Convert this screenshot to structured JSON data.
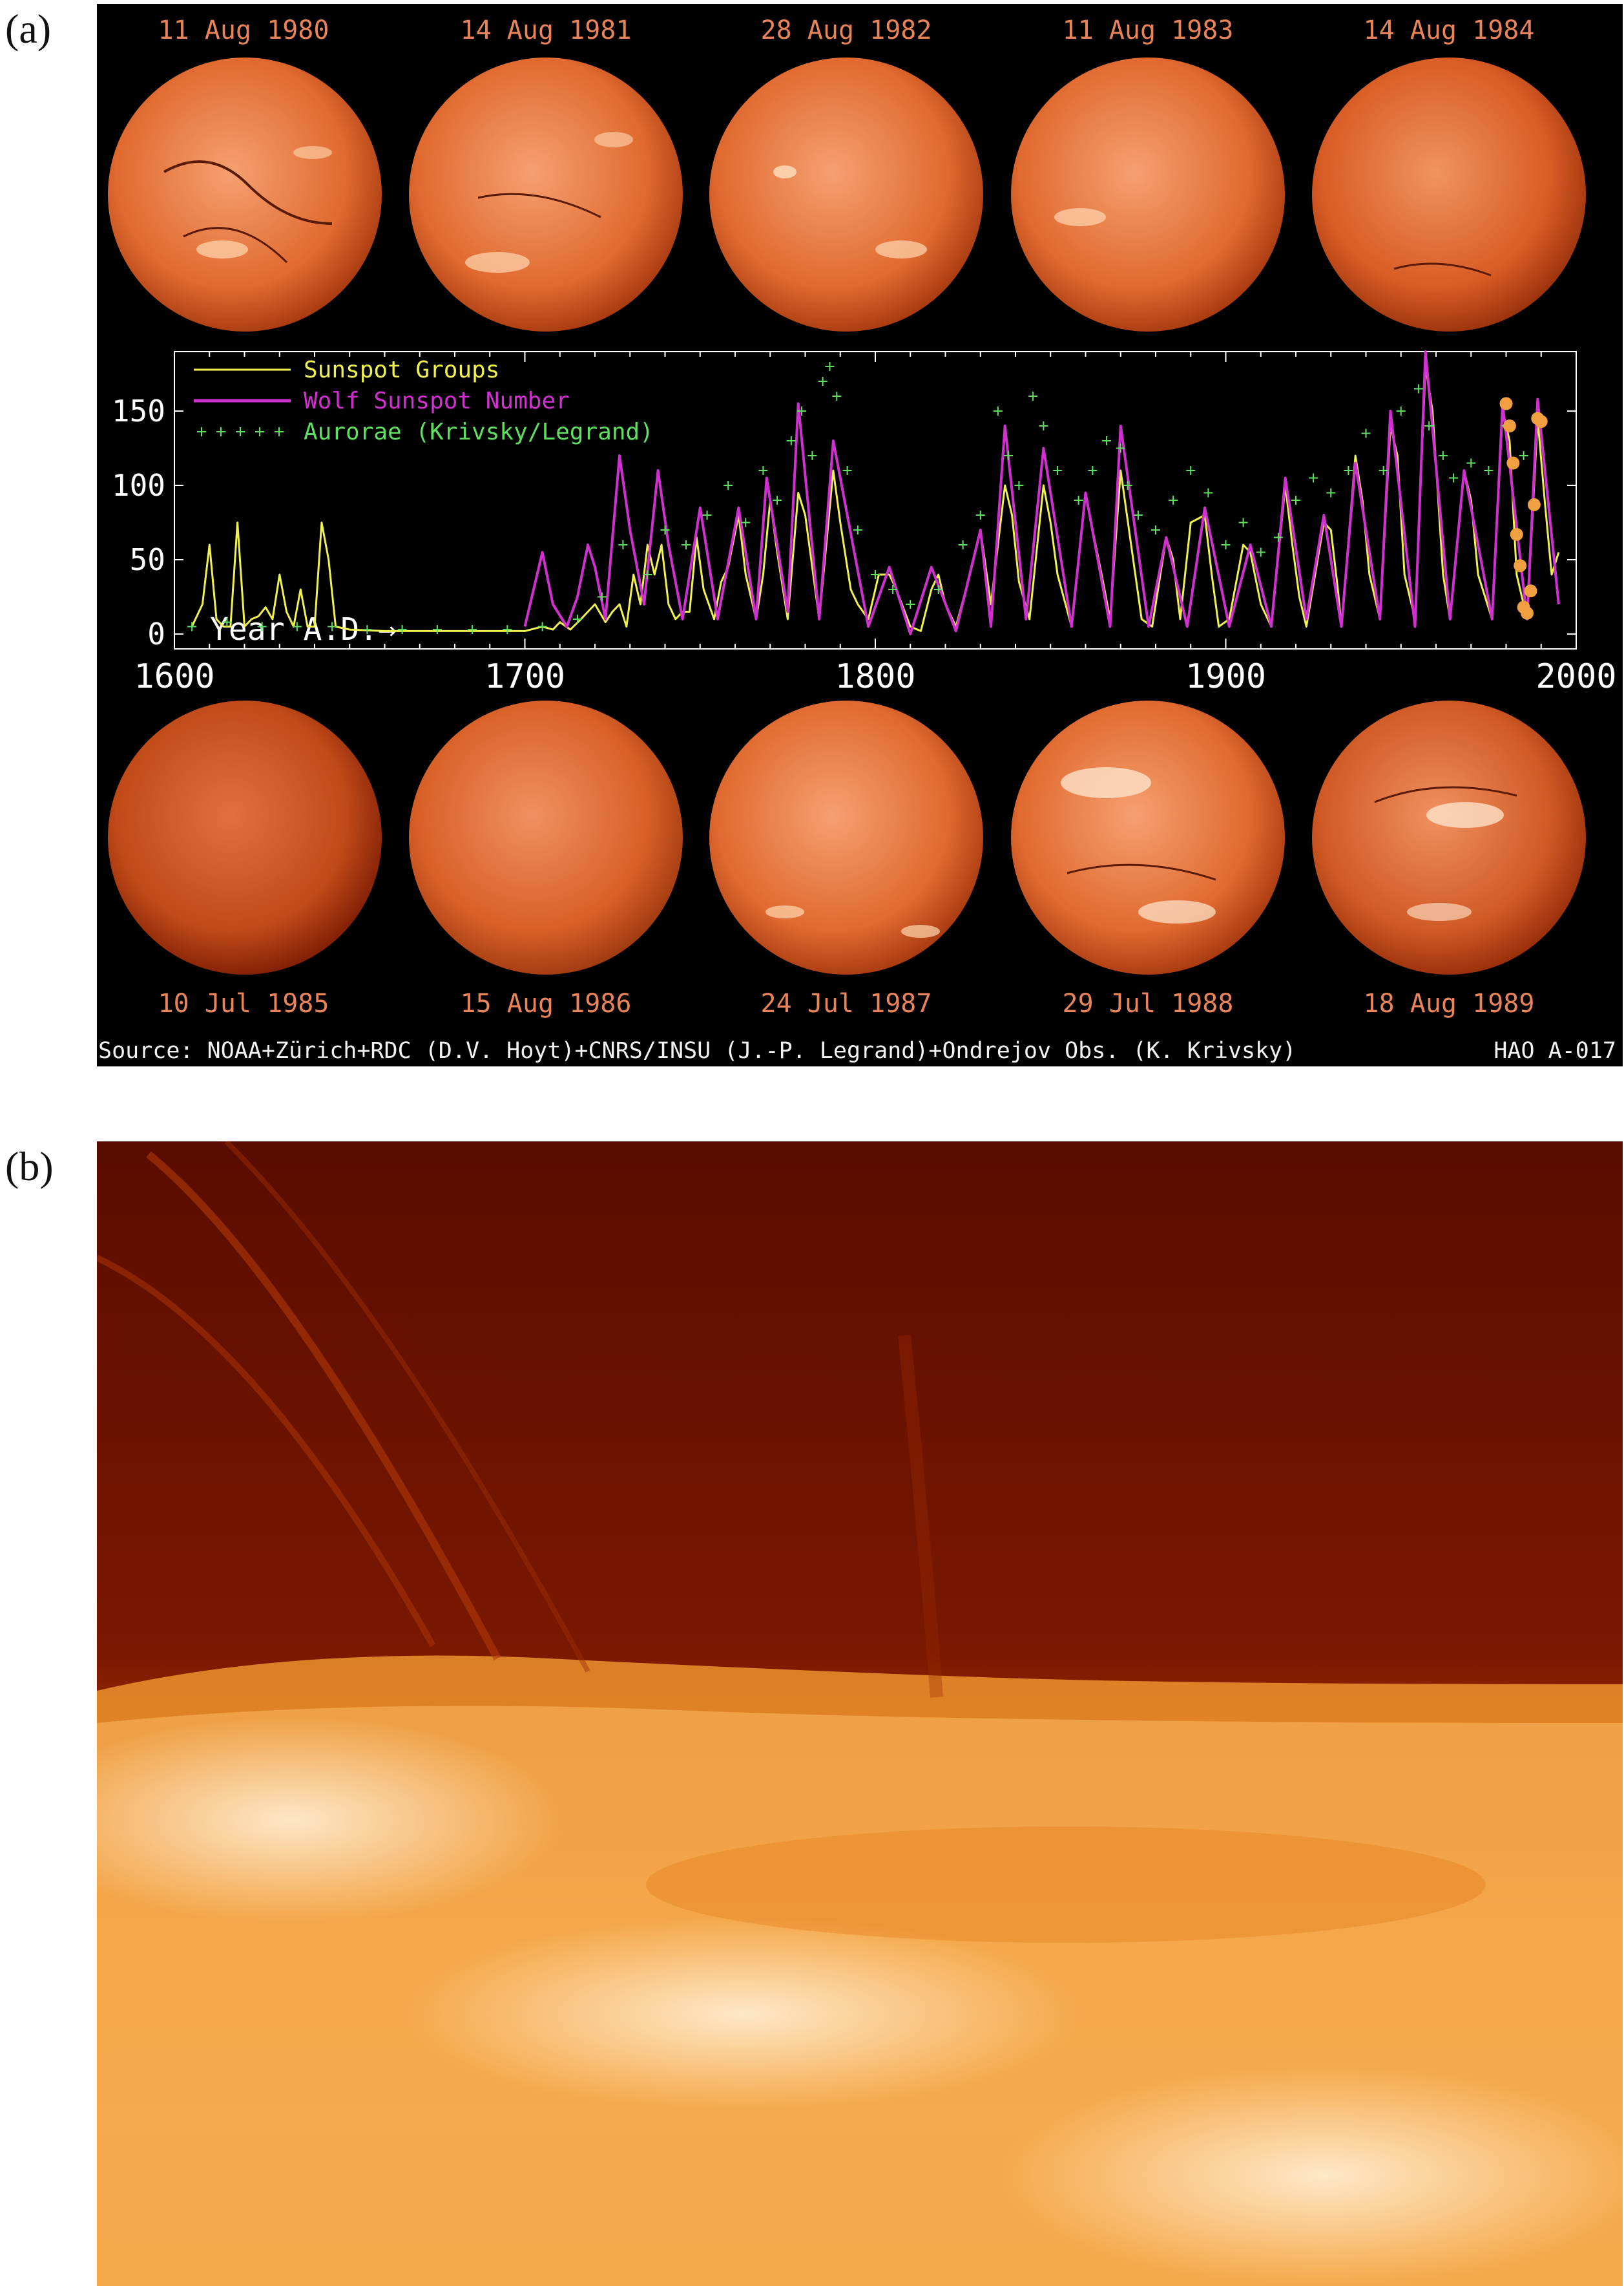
{
  "figure": {
    "panel_a_label": "(a)",
    "panel_b_label": "(b)"
  },
  "top_images": [
    "11 Aug 1980",
    "14 Aug 1981",
    "28 Aug 1982",
    "11 Aug 1983",
    "14 Aug 1984"
  ],
  "bottom_images": [
    "10 Jul 1985",
    "15 Aug 1986",
    "24 Jul 1987",
    "29 Jul 1988",
    "18 Aug 1989"
  ],
  "source_text": "Source: NOAA+Zürich+RDC (D.V. Hoyt)+CNRS/INSU (J.-P. Legrand)+Ondrejov Obs. (K. Krivsky)",
  "credit_text": "HAO A-017",
  "colors": {
    "background": "#000000",
    "sunspot_groups": "#f0f050",
    "wolf_number": "#d030d0",
    "aurorae": "#60e060",
    "axis_text": "#ffffff",
    "orange_markers": "#f0a040",
    "date_text": "#e8835a"
  },
  "chart_data": {
    "type": "line",
    "xlabel": "Year A.D.→",
    "xlim": [
      1600,
      2000
    ],
    "ylim": [
      -10,
      190
    ],
    "x_ticks": [
      1600,
      1700,
      1800,
      1900,
      2000
    ],
    "y_ticks": [
      0,
      50,
      100,
      150
    ],
    "legend_position": "top-left",
    "grid": false,
    "series": [
      {
        "name": "Sunspot Groups",
        "style": "line",
        "x": [
          1605,
          1608,
          1610,
          1612,
          1614,
          1616,
          1618,
          1620,
          1622,
          1624,
          1626,
          1628,
          1630,
          1632,
          1634,
          1636,
          1638,
          1640,
          1642,
          1644,
          1646,
          1650,
          1660,
          1670,
          1680,
          1690,
          1700,
          1705,
          1708,
          1710,
          1713,
          1716,
          1718,
          1720,
          1723,
          1725,
          1727,
          1729,
          1731,
          1733,
          1735,
          1737,
          1739,
          1741,
          1743,
          1745,
          1747,
          1749,
          1751,
          1754,
          1756,
          1758,
          1761,
          1763,
          1766,
          1768,
          1770,
          1772,
          1775,
          1778,
          1780,
          1784,
          1786,
          1788,
          1790,
          1793,
          1795,
          1798,
          1801,
          1804,
          1806,
          1810,
          1813,
          1816,
          1818,
          1820,
          1823,
          1827,
          1830,
          1833,
          1837,
          1839,
          1841,
          1844,
          1848,
          1850,
          1852,
          1856,
          1860,
          1862,
          1865,
          1867,
          1870,
          1873,
          1876,
          1879,
          1883,
          1885,
          1887,
          1890,
          1894,
          1896,
          1898,
          1901,
          1905,
          1907,
          1910,
          1913,
          1917,
          1919,
          1921,
          1923,
          1928,
          1930,
          1932,
          1933,
          1937,
          1939,
          1941,
          1944,
          1947,
          1949,
          1951,
          1954,
          1957,
          1959,
          1962,
          1964,
          1968,
          1970,
          1972,
          1976,
          1979,
          1981,
          1983,
          1986,
          1989,
          1991,
          1993,
          1995
        ],
        "values": [
          5,
          20,
          60,
          10,
          5,
          5,
          75,
          5,
          10,
          12,
          18,
          10,
          40,
          15,
          5,
          30,
          5,
          5,
          75,
          50,
          5,
          3,
          2,
          2,
          2,
          2,
          2,
          5,
          3,
          8,
          3,
          10,
          15,
          20,
          8,
          15,
          20,
          5,
          40,
          20,
          60,
          40,
          60,
          20,
          10,
          15,
          15,
          65,
          30,
          10,
          35,
          45,
          80,
          40,
          10,
          40,
          90,
          55,
          10,
          95,
          80,
          10,
          60,
          110,
          75,
          30,
          20,
          10,
          40,
          40,
          30,
          5,
          2,
          30,
          40,
          20,
          5,
          40,
          70,
          20,
          100,
          80,
          35,
          10,
          100,
          75,
          40,
          5,
          95,
          70,
          35,
          10,
          110,
          60,
          10,
          5,
          65,
          50,
          10,
          75,
          80,
          40,
          5,
          10,
          60,
          55,
          20,
          5,
          100,
          60,
          25,
          5,
          75,
          70,
          30,
          5,
          120,
          90,
          40,
          10,
          140,
          120,
          40,
          10,
          180,
          150,
          40,
          10,
          110,
          90,
          40,
          10,
          150,
          130,
          40,
          10,
          145,
          90,
          40,
          55
        ]
      },
      {
        "name": "Wolf Sunspot Number",
        "style": "line",
        "x": [
          1700,
          1705,
          1708,
          1712,
          1715,
          1718,
          1720,
          1723,
          1727,
          1730,
          1734,
          1738,
          1741,
          1745,
          1750,
          1755,
          1761,
          1766,
          1769,
          1775,
          1778,
          1784,
          1788,
          1798,
          1804,
          1810,
          1816,
          1823,
          1830,
          1833,
          1837,
          1843,
          1848,
          1856,
          1860,
          1867,
          1870,
          1878,
          1883,
          1889,
          1894,
          1901,
          1907,
          1913,
          1917,
          1923,
          1928,
          1933,
          1937,
          1944,
          1947,
          1954,
          1957,
          1964,
          1968,
          1976,
          1979,
          1986,
          1989,
          1995
        ],
        "values": [
          5,
          55,
          20,
          5,
          25,
          60,
          45,
          10,
          120,
          70,
          20,
          110,
          60,
          10,
          85,
          10,
          85,
          10,
          105,
          15,
          155,
          10,
          130,
          5,
          45,
          0,
          45,
          2,
          70,
          5,
          140,
          10,
          125,
          5,
          95,
          5,
          140,
          5,
          65,
          5,
          85,
          5,
          60,
          5,
          105,
          10,
          80,
          5,
          115,
          10,
          150,
          5,
          190,
          10,
          110,
          10,
          155,
          10,
          158,
          20
        ]
      },
      {
        "name": "Aurorae (Krivsky/Legrand)",
        "style": "markers",
        "x": [
          1605,
          1615,
          1625,
          1635,
          1645,
          1655,
          1665,
          1675,
          1685,
          1695,
          1705,
          1715,
          1722,
          1728,
          1735,
          1740,
          1746,
          1752,
          1758,
          1763,
          1768,
          1772,
          1776,
          1779,
          1782,
          1785,
          1787,
          1789,
          1792,
          1795,
          1800,
          1805,
          1810,
          1818,
          1825,
          1830,
          1835,
          1838,
          1841,
          1845,
          1848,
          1852,
          1858,
          1862,
          1866,
          1870,
          1872,
          1875,
          1880,
          1885,
          1890,
          1895,
          1900,
          1905,
          1910,
          1915,
          1920,
          1925,
          1930,
          1935,
          1940,
          1945,
          1950,
          1955,
          1958,
          1962,
          1965,
          1970,
          1975,
          1980,
          1985
        ],
        "values": [
          5,
          8,
          5,
          5,
          5,
          3,
          3,
          3,
          3,
          3,
          5,
          10,
          25,
          60,
          40,
          70,
          60,
          80,
          100,
          75,
          110,
          90,
          130,
          150,
          120,
          170,
          180,
          160,
          110,
          70,
          40,
          30,
          20,
          30,
          60,
          80,
          150,
          120,
          100,
          160,
          140,
          110,
          90,
          110,
          130,
          125,
          100,
          80,
          70,
          90,
          110,
          95,
          60,
          75,
          55,
          65,
          90,
          105,
          95,
          110,
          135,
          110,
          150,
          165,
          140,
          120,
          105,
          115,
          110,
          140,
          120
        ]
      },
      {
        "name": "",
        "style": "orange-dots",
        "x": [
          1980,
          1981,
          1982,
          1983,
          1984,
          1985,
          1986,
          1987,
          1988,
          1989,
          1990
        ],
        "values": [
          155,
          140,
          115,
          67,
          46,
          18,
          14,
          29,
          87,
          145,
          143
        ]
      }
    ]
  }
}
